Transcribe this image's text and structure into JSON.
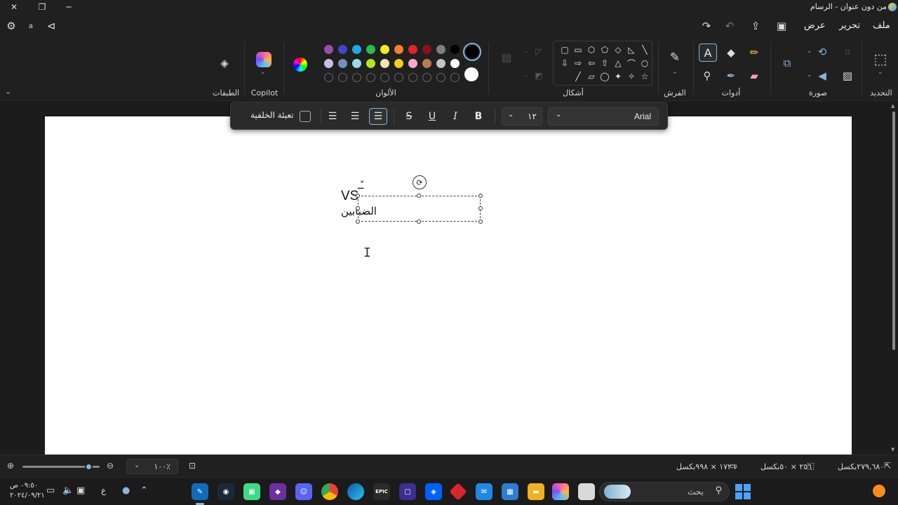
{
  "window": {
    "title": "من دون عنوان - الرسام",
    "close_glyph": "✕",
    "restore_glyph": "❐",
    "min_glyph": "─"
  },
  "menu": {
    "file": "ملف",
    "edit": "تحرير",
    "view": "عرض"
  },
  "ribbon": {
    "groups": {
      "selection": "التحديد",
      "image": "صورة",
      "tools": "أدوات",
      "brushes": "الفرش",
      "shapes": "أشكال",
      "colors": "الألوان",
      "copilot": "Copilot",
      "layers": "الطبقات"
    },
    "colors_row1": [
      "#000000",
      "#7f7f7f",
      "#8b0f1e",
      "#e3242b",
      "#f28030",
      "#f4ec1b",
      "#2bbb4c",
      "#1fa9e1",
      "#3f47cc",
      "#9b4ea5"
    ],
    "colors_row2": [
      "#ffffff",
      "#c3c3c3",
      "#b97a57",
      "#f7a9c8",
      "#f5cc1f",
      "#efe4b0",
      "#b5e61d",
      "#99d9ea",
      "#7092be",
      "#c8bfe7"
    ],
    "primary_color": "#000000",
    "secondary_color": "#ffffff",
    "shapes": [
      "╲",
      "◺",
      "◇",
      "⬠",
      "⬡",
      "▭",
      "▢",
      "○",
      "⌒",
      "△",
      "⇧",
      "⇦",
      "⇨",
      "⇩",
      "☆",
      "✧",
      "✦",
      "◯",
      "▱",
      "╱"
    ]
  },
  "text_toolbar": {
    "font": "Arial",
    "size": "١٢",
    "bold": "B",
    "italic": "I",
    "underline": "U",
    "strikethrough": "S",
    "fill_background_label": "تعبئة الخلفية"
  },
  "canvas": {
    "text_vs": "VS",
    "text_line2": "الضبابين",
    "text_partial": "ـًـ"
  },
  "status": {
    "cursor_pos": "٢٧٩,٦٨٠بكسل",
    "selection_size": "٢٥٦ × ٥٠بكسل",
    "image_size": "١٧٢٦ × ٩٩٨بكسل",
    "zoom": "١٠٠٪"
  },
  "taskbar": {
    "search_placeholder": "بحث",
    "time": "٠٩:٥٠ ص",
    "date": "٢٠٢٤/٠٩/٢١",
    "language": "ع"
  }
}
